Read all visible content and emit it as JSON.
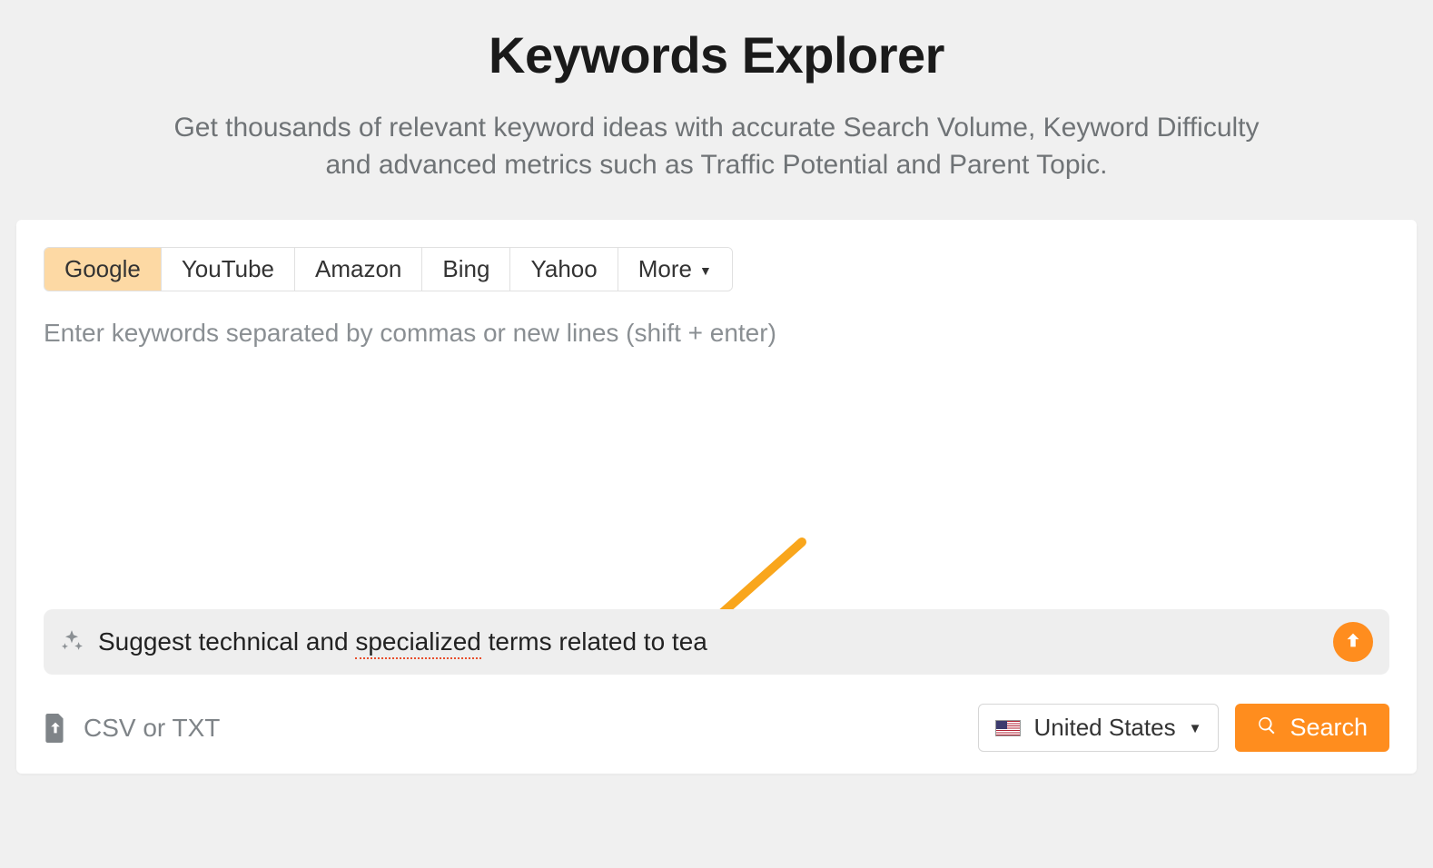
{
  "header": {
    "title": "Keywords Explorer",
    "subtitle": "Get thousands of relevant keyword ideas with accurate Search Volume, Keyword Difficulty and advanced metrics such as Traffic Potential and Parent Topic."
  },
  "engines": {
    "items": [
      "Google",
      "YouTube",
      "Amazon",
      "Bing",
      "Yahoo"
    ],
    "more_label": "More",
    "active": "Google"
  },
  "textarea": {
    "placeholder": "Enter keywords separated by commas or new lines (shift + enter)"
  },
  "ai_prompt": {
    "prefix": "Suggest technical and ",
    "flagged_word": "specialized",
    "suffix": " terms related to tea"
  },
  "upload": {
    "label": "CSV or TXT"
  },
  "country": {
    "selected": "United States"
  },
  "search": {
    "label": "Search"
  }
}
